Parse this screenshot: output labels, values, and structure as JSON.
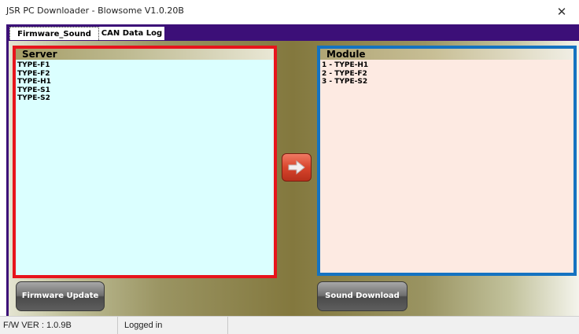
{
  "window": {
    "title": "JSR PC Downloader - Blowsome V1.0.20B",
    "close_symbol": "✕"
  },
  "tabs": [
    {
      "label": "Firmware_Sound",
      "active": true
    },
    {
      "label": "CAN Data Log",
      "active": false
    }
  ],
  "server_panel": {
    "header": "Server",
    "items": [
      "TYPE-F1",
      "TYPE-F2",
      "TYPE-H1",
      "TYPE-S1",
      "TYPE-S2"
    ]
  },
  "module_panel": {
    "header": "Module",
    "items": [
      "1 - TYPE-H1",
      "2 - TYPE-F2",
      "3 - TYPE-S2"
    ]
  },
  "transfer_button": {
    "icon": "arrow-right-icon"
  },
  "buttons": {
    "firmware_update": "Firmware Update",
    "sound_download": "Sound Download"
  },
  "statusbar": {
    "fw_version": "F/W VER : 1.0.9B",
    "login_status": "Logged in"
  },
  "colors": {
    "tab_strip": "#3c0f78",
    "server_border": "#e8141c",
    "module_border": "#1473c1",
    "server_bg": "#dbffff",
    "module_bg": "#fdeae2",
    "arrow_button": "#d8452c"
  }
}
